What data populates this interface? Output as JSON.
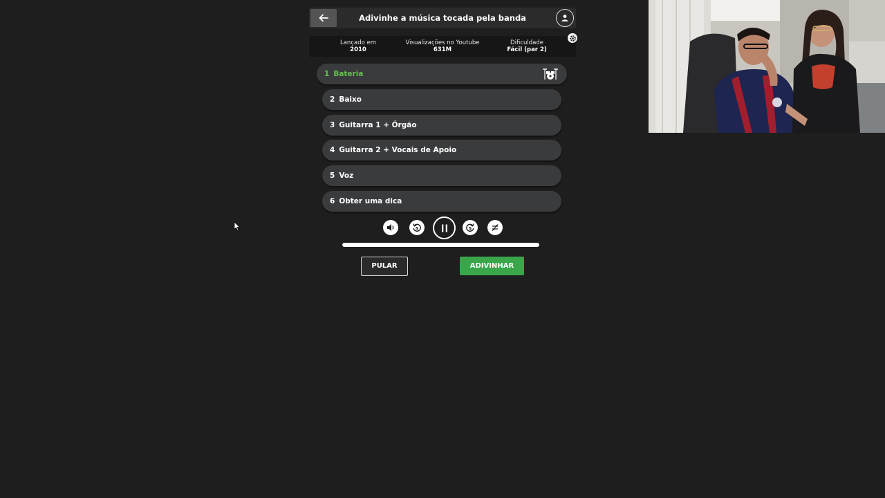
{
  "header": {
    "title": "Adivinhe a música tocada pela banda",
    "back_icon": "arrow-left-icon",
    "account_icon": "user-icon"
  },
  "info": {
    "released_label": "Lançado em",
    "released_value": "2010",
    "views_label": "Visualizações no Youtube",
    "views_value": "631M",
    "difficulty_label": "Dificuldade",
    "difficulty_value": "Fácil (par 2)",
    "settings_icon": "gear-icon"
  },
  "tracks": [
    {
      "num": "1",
      "label": "Bateria",
      "active": true,
      "icon": "drum-kit-icon"
    },
    {
      "num": "2",
      "label": "Baixo",
      "active": false
    },
    {
      "num": "3",
      "label": "Guitarra 1 + Órgão",
      "active": false
    },
    {
      "num": "4",
      "label": "Guitarra 2 + Vocais de Apoio",
      "active": false
    },
    {
      "num": "5",
      "label": "Voz",
      "active": false
    },
    {
      "num": "6",
      "label": "Obter uma dica",
      "active": false
    }
  ],
  "player": {
    "volume_icon": "volume-icon",
    "rewind_icon": "rewind-5-icon",
    "pause_icon": "pause-icon",
    "forward_icon": "forward-5-icon",
    "shuffle_icon": "repeat-off-icon",
    "progress": 1.0
  },
  "actions": {
    "skip_label": "PULAR",
    "guess_label": "ADIVINHAR"
  },
  "colors": {
    "background": "#1e1e1e",
    "active_track": "#5fc34a",
    "guess_button": "#3aa64a",
    "track_bg": "#3a3b3d"
  }
}
